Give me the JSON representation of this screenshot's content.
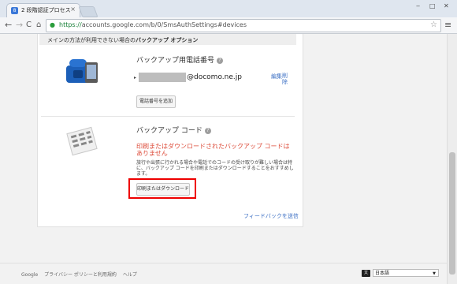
{
  "browser": {
    "tab_title": "2 段階認証プロセス",
    "tab_favicon": "8",
    "tab_close": "×",
    "url_https": "https://",
    "url_rest": "accounts.google.com/b/0/SmsAuthSettings#devices",
    "window_controls": {
      "minimize": "‒",
      "maximize": "□",
      "close": "✕"
    },
    "back_glyph": "←",
    "forward_glyph": "→",
    "reload_glyph": "C",
    "home_glyph": "⌂",
    "lock_glyph": "🔒",
    "star_glyph": "☆",
    "menu_glyph": "≡"
  },
  "options_bar": {
    "prefix": "メインの方法が利用できない場合の",
    "bold": "バックアップ オプション"
  },
  "backup_phone": {
    "title": "バックアップ用電話番号",
    "bullet": "▸",
    "email_domain": "@docomo.ne.jp",
    "edit_label": "編集",
    "delete_label": "削除",
    "add_button": "電話番号を追加"
  },
  "backup_codes": {
    "title": "バックアップ コード",
    "warning": "印刷またはダウンロードされたバックアップ コードはありません",
    "description": "旅行や出張に行かれる場合や電話でのコードの受け取りが難しい場合は特に、バックアップ コードを印刷またはダウンロードすることをおすすめします。",
    "print_button": "印刷またはダウンロード"
  },
  "help_icon_glyph": "?",
  "feedback_link": "フィードバックを送信",
  "footer": {
    "google": "Google",
    "privacy": "プライバシー ポリシーと利用規約",
    "help": "ヘルプ",
    "lang_icon_text": "文",
    "language": "日本語",
    "caret": "▼"
  },
  "colors": {
    "accent_link": "#3b6fc4",
    "warning_red": "#dd4b39",
    "highlight_box": "#ee0000"
  },
  "icons": [
    "phone-icon",
    "backup-codes-icon",
    "lock-icon",
    "star-icon",
    "menu-icon",
    "help-icon",
    "language-icon"
  ]
}
